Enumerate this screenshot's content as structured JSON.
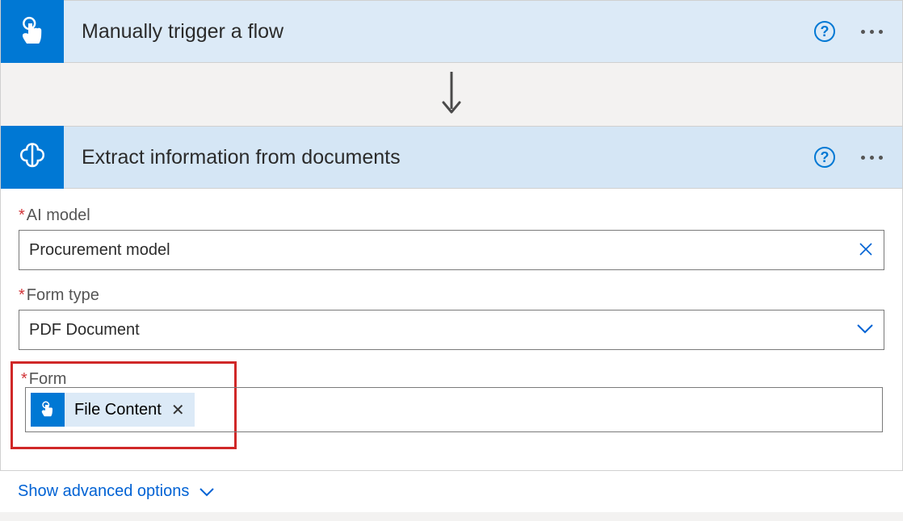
{
  "trigger": {
    "title": "Manually trigger a flow",
    "icon": "touch-icon"
  },
  "action": {
    "title": "Extract information from documents",
    "icon": "brain-icon",
    "fields": {
      "ai_model": {
        "label": "AI model",
        "required": true,
        "value": "Procurement model"
      },
      "form_type": {
        "label": "Form type",
        "required": true,
        "value": "PDF Document"
      },
      "form": {
        "label": "Form",
        "required": true,
        "token": {
          "label": "File Content",
          "source_icon": "touch-icon"
        }
      }
    },
    "show_advanced_label": "Show advanced options"
  }
}
